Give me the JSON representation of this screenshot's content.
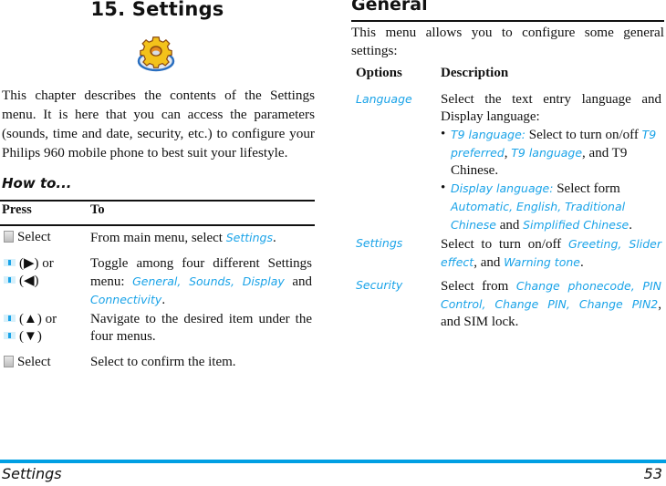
{
  "left": {
    "chapter_title": "15. Settings",
    "chapter_icon": "settings-gear-icon",
    "intro": "This chapter describes the contents of the Settings menu. It is here that you can access the parameters (sounds, time and date, security, etc.) to configure your Philips 960 mobile phone to best suit your lifestyle.",
    "howto_heading": "How to...",
    "table": {
      "headers": [
        "Press",
        "To"
      ],
      "rows": [
        {
          "press": [
            {
              "icon": "softkey-icon",
              "text": "Select"
            }
          ],
          "to": [
            {
              "t": "From main menu, select "
            },
            {
              "t": "Settings",
              "hl": true
            },
            {
              "t": "."
            }
          ]
        },
        {
          "press": [
            {
              "icon": "nav-key-icon",
              "text": "(▶) or"
            },
            {
              "icon": "nav-key-icon",
              "text": "(◀)"
            }
          ],
          "to": [
            {
              "t": "Toggle among four different Settings menu: "
            },
            {
              "t": "General, Sounds, Display",
              "hl": true
            },
            {
              "t": " and "
            },
            {
              "t": "Connectivity",
              "hl": true
            },
            {
              "t": "."
            }
          ]
        },
        {
          "press": [
            {
              "icon": "nav-key-icon",
              "text": "(▲) or"
            },
            {
              "icon": "nav-key-icon",
              "text": "(▼)"
            }
          ],
          "to": [
            {
              "t": "Navigate to the desired item under the four menus."
            }
          ]
        },
        {
          "press": [
            {
              "icon": "softkey-icon",
              "text": "Select"
            }
          ],
          "to": [
            {
              "t": "Select to confirm the item."
            }
          ]
        }
      ]
    }
  },
  "right": {
    "section_title": "General",
    "intro": "This menu allows you to configure some general settings:",
    "table": {
      "headers": [
        "Options",
        "Description"
      ],
      "rows": [
        {
          "option": "Language",
          "desc": [
            {
              "t": "Select the text entry language and Display language:"
            }
          ],
          "bullets": [
            [
              {
                "t": "T9 language:",
                "hl": true
              },
              {
                "t": " Select to turn on/off "
              },
              {
                "t": "T9 preferred",
                "hl": true
              },
              {
                "t": ", "
              },
              {
                "t": "T9 language",
                "hl": true
              },
              {
                "t": ", and T9 Chinese."
              }
            ],
            [
              {
                "t": "Display language:",
                "hl": true
              },
              {
                "t": " Select form "
              },
              {
                "t": "Automatic, English, Traditional Chinese",
                "hl": true
              },
              {
                "t": " and "
              },
              {
                "t": "Simplified Chinese",
                "hl": true
              },
              {
                "t": "."
              }
            ]
          ]
        },
        {
          "option": "Settings",
          "desc": [
            {
              "t": "Select to turn on/off "
            },
            {
              "t": "Greeting, Slider effect",
              "hl": true
            },
            {
              "t": ", and "
            },
            {
              "t": "Warning tone",
              "hl": true
            },
            {
              "t": "."
            }
          ]
        },
        {
          "option": "Security",
          "desc": [
            {
              "t": "Select from "
            },
            {
              "t": "Change phonecode, PIN Control, Change PIN, Change PIN2",
              "hl": true
            },
            {
              "t": ", and SIM lock."
            }
          ]
        }
      ]
    }
  },
  "footer": {
    "title": "Settings",
    "page_number": "53",
    "accent_color": "#009fe3"
  },
  "colors": {
    "highlight": "#1aa3e8",
    "text": "#111111"
  }
}
